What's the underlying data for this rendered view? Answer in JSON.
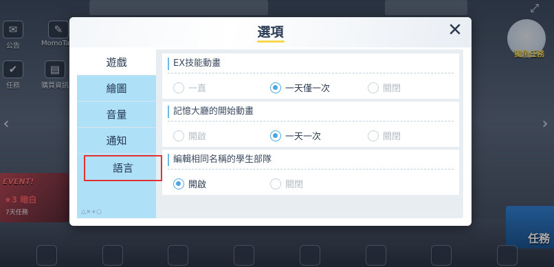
{
  "background": {
    "top_left_buttons": [
      {
        "label": "公告",
        "icon": "megaphone-icon"
      },
      {
        "label": "MomoTalk",
        "icon": "chat-icon"
      }
    ],
    "second_row_buttons": [
      {
        "label": "任務",
        "icon": "checklist-icon"
      },
      {
        "label": "購買資訊",
        "icon": "shop-icon"
      }
    ],
    "event": {
      "label": "EVENT!",
      "sub": "★3 暗白",
      "note": "7天任務"
    },
    "mascot_label": "獨角任務",
    "quest_button_label": "任務"
  },
  "dialog": {
    "title": "選項",
    "close_icon": "close-icon",
    "sidebar": {
      "items": [
        {
          "label": "遊戲",
          "active": true
        },
        {
          "label": "繪圖",
          "active": false
        },
        {
          "label": "音量",
          "active": false
        },
        {
          "label": "通知",
          "active": false
        },
        {
          "label": "語言",
          "active": false,
          "highlighted": true
        }
      ],
      "footer": "△×+○"
    },
    "sections": [
      {
        "title": "EX技能動畫",
        "options": [
          {
            "label": "一直",
            "checked": false
          },
          {
            "label": "一天僅一次",
            "checked": true
          },
          {
            "label": "關閉",
            "checked": false
          }
        ]
      },
      {
        "title": "記憶大廳的開始動畫",
        "options": [
          {
            "label": "開啟",
            "checked": false
          },
          {
            "label": "一天一次",
            "checked": true
          },
          {
            "label": "關閉",
            "checked": false
          }
        ]
      },
      {
        "title": "編輯相同名稱的學生部隊",
        "options": [
          {
            "label": "開啟",
            "checked": true
          },
          {
            "label": "關閉",
            "checked": false
          }
        ]
      }
    ]
  },
  "colors": {
    "accent": "#4aa6e6",
    "sidebar_bg": "#aee0f7",
    "highlight_box": "#e2312f",
    "title_underline": "#f6d64a"
  }
}
